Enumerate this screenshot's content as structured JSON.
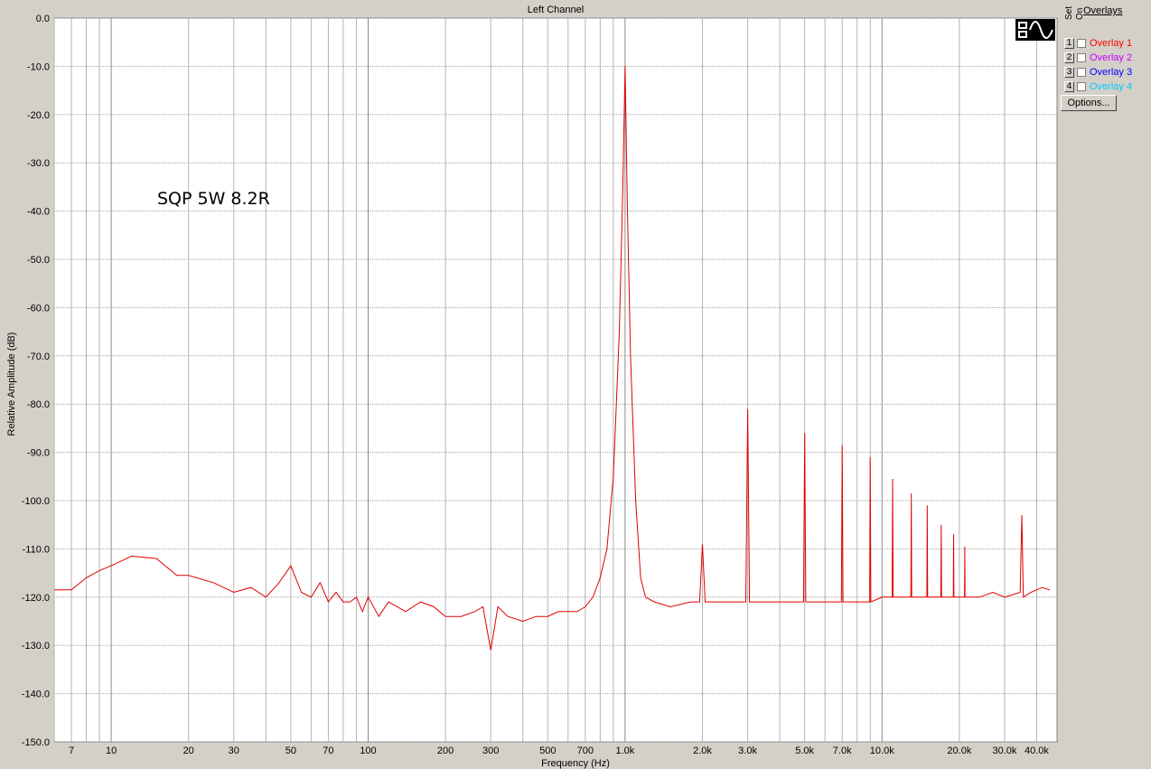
{
  "chart_data": {
    "type": "line",
    "title": "Left Channel",
    "xlabel": "Frequency (Hz)",
    "ylabel": "Relative Amplitude (dB)",
    "annotation": "SQP 5W 8.2R",
    "x_scale": "log",
    "xlim": [
      6,
      48000
    ],
    "ylim": [
      -150,
      0
    ],
    "grid": true,
    "y_ticks": [
      0,
      -10,
      -20,
      -30,
      -40,
      -50,
      -60,
      -70,
      -80,
      -90,
      -100,
      -110,
      -120,
      -130,
      -140,
      -150
    ],
    "y_tick_labels": [
      "0.0",
      "-10.0",
      "-20.0",
      "-30.0",
      "-40.0",
      "-50.0",
      "-60.0",
      "-70.0",
      "-80.0",
      "-90.0",
      "-100.0",
      "-110.0",
      "-120.0",
      "-130.0",
      "-140.0",
      "-150.0"
    ],
    "x_ticks": [
      7,
      10,
      20,
      30,
      50,
      70,
      100,
      200,
      300,
      500,
      700,
      1000,
      2000,
      3000,
      5000,
      7000,
      10000,
      20000,
      30000,
      40000
    ],
    "x_tick_labels": [
      "7",
      "10",
      "20",
      "30",
      "50",
      "70",
      "100",
      "200",
      "300",
      "500",
      "700",
      "1.0k",
      "2.0k",
      "3.0k",
      "5.0k",
      "7.0k",
      "10.0k",
      "20.0k",
      "30.0k",
      "40.0k"
    ],
    "series": [
      {
        "color": "#e00000",
        "x": [
          6,
          7,
          8,
          9,
          10,
          12,
          15,
          18,
          20,
          25,
          30,
          35,
          40,
          45,
          50,
          55,
          60,
          65,
          70,
          75,
          80,
          85,
          90,
          95,
          100,
          110,
          120,
          140,
          160,
          180,
          200,
          230,
          260,
          280,
          300,
          320,
          350,
          400,
          450,
          500,
          550,
          600,
          650,
          700,
          750,
          800,
          850,
          900,
          950,
          980,
          1000,
          1020,
          1050,
          1100,
          1150,
          1200,
          1300,
          1500,
          1800,
          1950,
          2000,
          2050,
          2200,
          2600,
          2950,
          3000,
          3050,
          3500,
          4000,
          4500,
          4950,
          5000,
          5050,
          6000,
          6950,
          7000,
          7050,
          8000,
          8950,
          9000,
          9050,
          10000,
          10950,
          11000,
          11050,
          12000,
          12950,
          13000,
          13050,
          14000,
          14950,
          15000,
          15050,
          16000,
          16950,
          17000,
          17050,
          18000,
          18950,
          19000,
          19050,
          20000,
          20950,
          21000,
          21050,
          22000,
          24000,
          27000,
          30000,
          34500,
          35000,
          35500,
          38000,
          42000,
          45000
        ],
        "y": [
          -118.5,
          -118.5,
          -116,
          -114.5,
          -113.5,
          -111.5,
          -112,
          -115.5,
          -115.5,
          -117,
          -119,
          -118,
          -120,
          -117,
          -113.5,
          -119,
          -120,
          -117,
          -121,
          -119,
          -121,
          -121,
          -120,
          -123,
          -120,
          -124,
          -121,
          -123,
          -121,
          -122,
          -124,
          -124,
          -123,
          -122,
          -131,
          -122,
          -124,
          -125,
          -124,
          -124,
          -123,
          -123,
          -123,
          -122,
          -120,
          -116,
          -110,
          -95,
          -65,
          -35,
          -10,
          -38,
          -70,
          -100,
          -116,
          -120,
          -121,
          -122,
          -121,
          -121,
          -109,
          -121,
          -121,
          -121,
          -121,
          -81,
          -121,
          -121,
          -121,
          -121,
          -121,
          -86,
          -121,
          -121,
          -121,
          -88.5,
          -121,
          -121,
          -121,
          -91,
          -121,
          -120,
          -120,
          -95.5,
          -120,
          -120,
          -120,
          -98.5,
          -120,
          -120,
          -120,
          -101,
          -120,
          -120,
          -120,
          -105,
          -120,
          -120,
          -120,
          -107,
          -120,
          -120,
          -120,
          -109.5,
          -120,
          -120,
          -120,
          -119,
          -120,
          -119,
          -103,
          -120,
          -119,
          -118,
          -118.5
        ]
      }
    ]
  },
  "overlays": {
    "title": "Overlays",
    "set_label": "Set",
    "on_label": "On",
    "items": [
      {
        "num": "1",
        "label": "Overlay 1",
        "color": "#ff0000"
      },
      {
        "num": "2",
        "label": "Overlay 2",
        "color": "#cc00ff"
      },
      {
        "num": "3",
        "label": "Overlay 3",
        "color": "#0000ff"
      },
      {
        "num": "4",
        "label": "Overlay 4",
        "color": "#00ccff"
      }
    ],
    "options_label": "Options..."
  },
  "logo_icon": "sine-wave-logo-icon"
}
